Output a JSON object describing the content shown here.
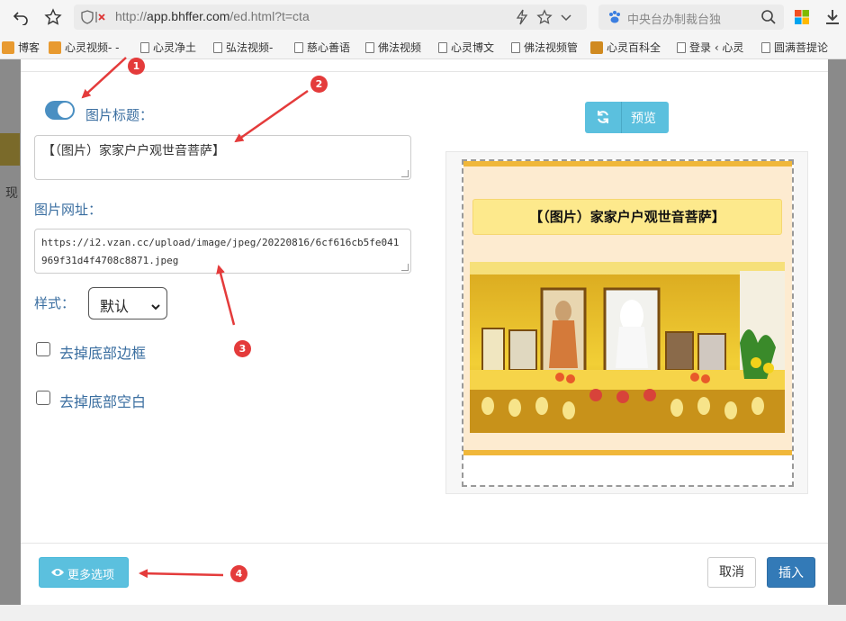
{
  "browser": {
    "url_prefix": "http://",
    "url_domain": "app.bhffer.com",
    "url_path": "/ed.html?t=cta",
    "search_placeholder": "中央台办制裁台独"
  },
  "bookmarks": [
    {
      "label": "博客",
      "icon": "orange-sq"
    },
    {
      "label": "心灵视频- -",
      "icon": "orange-sq"
    },
    {
      "label": "心灵净土",
      "icon": "doc"
    },
    {
      "label": "弘法视频-",
      "icon": "doc"
    },
    {
      "label": "慈心善语",
      "icon": "doc"
    },
    {
      "label": "佛法视频",
      "icon": "doc"
    },
    {
      "label": "心灵博文",
      "icon": "doc"
    },
    {
      "label": "佛法视频管",
      "icon": "doc"
    },
    {
      "label": "心灵百科全",
      "icon": "orange-sq"
    },
    {
      "label": "登录 ‹ 心灵",
      "icon": "doc"
    },
    {
      "label": "圆满菩提论",
      "icon": "doc"
    }
  ],
  "page_behind": {
    "text": "现"
  },
  "form": {
    "title_label": "图片标题：",
    "title_value": "【（图片）家家户户观世音菩萨】",
    "url_label": "图片网址：",
    "url_value": "https://i2.vzan.cc/upload/image/jpeg/20220816/6cf616cb5fe041969f31d4f4708c8871.jpeg",
    "style_label": "样式：",
    "style_value": "默认",
    "remove_border_label": "去掉底部边框",
    "remove_space_label": "去掉底部空白"
  },
  "preview": {
    "button_label": "预览",
    "card_title": "【（图片）家家户户观世音菩萨】"
  },
  "footer": {
    "more_options": "更多选项",
    "cancel": "取消",
    "insert": "插入"
  },
  "annotations": [
    "1",
    "2",
    "3",
    "4"
  ],
  "colors": {
    "accent_info": "#5bc0de",
    "primary": "#337ab7",
    "label_blue": "#3a6ea0",
    "annotation_red": "#e43b3b"
  }
}
